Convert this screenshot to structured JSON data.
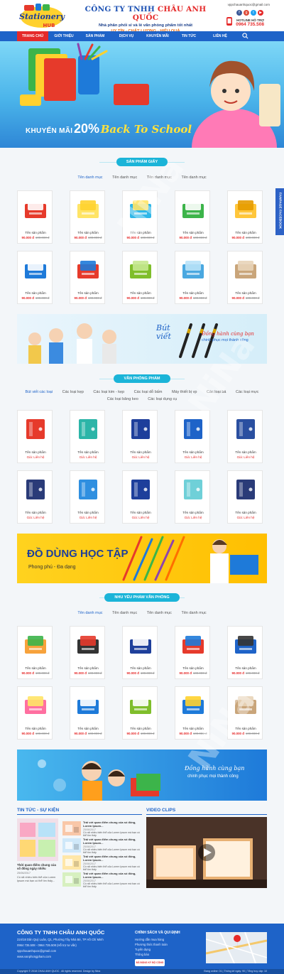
{
  "header": {
    "company_prefix": "CÔNG TY TNHH ",
    "company_highlight": "CHÂU ANH QUỐC",
    "slogan": "Nhà phân phối sỉ và lẻ văn phòng phẩm tốt nhất",
    "motto": "UY TÍN - CHẤT LƯỢNG - HIỆU QUẢ",
    "email": "vppchauanhquoc@gmail.com",
    "hotline_label": "HOTLINE HỖ TRỢ",
    "hotline": "0964 735.508",
    "logo_word1": "Stationery",
    "logo_word2": "HUB"
  },
  "nav": {
    "items": [
      "TRANG CHỦ",
      "GIỚI THIỆU",
      "SẢN PHẨM",
      "DỊCH VỤ",
      "KHUYẾN MÃI",
      "TIN TỨC",
      "LIÊN HỆ"
    ],
    "active": 0
  },
  "banner": {
    "promo_label": "KHUYẾN MÃI",
    "promo_percent": "20%",
    "promo_text": "Back To School"
  },
  "facebook_tab": "FANPAGE FACEBOOK",
  "section_paper": {
    "title": "SẢN PHẨM GIẤY",
    "tabs": [
      "Tên danh mục",
      "Tên danh mục",
      "Tên danh mục",
      "Tên danh mục"
    ],
    "product_name": "Tên sản phẩm",
    "price": "90.000 đ",
    "old_price": "100.000 đ"
  },
  "banner_pen": {
    "title": "Bút viết",
    "line1": "Đồng hành cùng bạn",
    "line2": "chinh phục mọi thành công"
  },
  "section_office": {
    "title": "VĂN PHÒNG PHẨM",
    "tabs_row1": [
      "Bút viết các loại",
      "Các loại kẹp",
      "Các loại kim - kẹp",
      "Các loại dỗ bấm",
      "Máy thiết bị vp",
      "Các loại bá",
      "Các loại mực"
    ],
    "tabs_row2": [
      "Các loại băng keo",
      "Các loại dụng cụ"
    ],
    "product_name": "Tên sản phẩm",
    "contact": "Giá: Liên hệ"
  },
  "banner_school": {
    "title": "ĐỒ DÙNG HỌC TẬP",
    "subtitle": "Phong phú - Đa dạng"
  },
  "section_needs": {
    "title": "NHU YẾU PHẨM VĂN PHÒNG",
    "tabs": [
      "Tên danh mục",
      "Tên danh mục",
      "Tên danh mục",
      "Tên danh mục"
    ],
    "product_name": "Tên sản phẩm",
    "price": "90.000 đ",
    "old_price": "100.000 đ"
  },
  "banner_kids": {
    "line1": "Đồng hành cùng bạn",
    "line2": "chinh phục mọi thành công"
  },
  "news": {
    "title": "TIN TỨC - SỰ KIỆN",
    "main_title": "Thời quan điểm chung của số đông ngày nhiều",
    "main_date": "25/06/2017",
    "main_text": "Có rất nhiều biến thể của Lorem Ipsum mà bạn có thể tìm thấy...",
    "items": [
      {
        "t": "Trái với quan điểm chung của số đông, Lorem Ipsum...",
        "d": "25/06/2017",
        "x": "Có rất nhiều biến thể của Lorem Ipsum mà bạn có thể tìm thấy"
      },
      {
        "t": "Trái với quan điểm chung của số đông, Lorem Ipsum...",
        "d": "25/06/2017",
        "x": "Có rất nhiều biến thể của Lorem Ipsum mà bạn có thể tìm thấy"
      },
      {
        "t": "Trái với quan điểm chung của số đông, Lorem Ipsum...",
        "d": "25/06/2017",
        "x": "Có rất nhiều biến thể của Lorem Ipsum mà bạn có thể tìm thấy"
      },
      {
        "t": "Trái với quan điểm chung của số đông, Lorem Ipsum...",
        "d": "25/06/2017",
        "x": "Có rất nhiều biến thể của Lorem Ipsum mà bạn có thể tìm thấy"
      }
    ]
  },
  "video": {
    "title": "VIDEO CLIPS"
  },
  "footer": {
    "company": "CÔNG TY TNHH CHÂU ANH QUỐC",
    "address": "224/18 Dân Quý Luân, Q1, Phường Tây Nhà Bè, TP Hồ Chí Minh",
    "phone": "0964 735.508 - 0964 735.508 (Hỗ trợ tư vấn)",
    "email": "vppchauanhquoc@gmail.com",
    "web": "www.vanphongpham.com",
    "policy_title": "CHÍNH SÁCH VÀ QUI ĐỊNH",
    "policies": [
      "Hướng dẫn mua hàng",
      "Phương thức thanh toán",
      "Tuyển dụng",
      "Thông báo"
    ],
    "bct": "ĐÃ ĐĂNG KÝ BỘ CÔNG THƯƠNG"
  },
  "copyright": {
    "left": "Copyright © 2018 CHAU ANH QUOC . All rights reserved. Design by Nina",
    "right": "Đang online: 01 | Thống kê ngày: 90 | Tổng truy cập: 10"
  },
  "watermark": "NiNa"
}
